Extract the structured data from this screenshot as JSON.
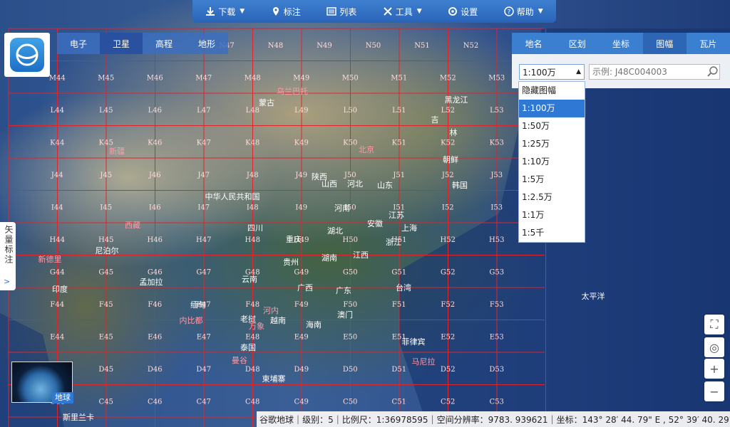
{
  "toolbar": {
    "items": [
      {
        "label": "下载",
        "icon": "download-icon",
        "has_caret": true
      },
      {
        "label": "标注",
        "icon": "location-pin-icon",
        "has_caret": false
      },
      {
        "label": "列表",
        "icon": "list-icon",
        "has_caret": false
      },
      {
        "label": "工具",
        "icon": "tools-icon",
        "has_caret": true
      },
      {
        "label": "设置",
        "icon": "gear-icon",
        "has_caret": false
      },
      {
        "label": "帮助",
        "icon": "help-icon",
        "has_caret": true
      }
    ]
  },
  "map_tabs": [
    "电子",
    "卫星",
    "高程",
    "地形"
  ],
  "map_tabs_active": "卫星",
  "panel": {
    "tabs": [
      "地名",
      "区划",
      "坐标",
      "图幅",
      "瓦片"
    ],
    "active_tab": "图幅",
    "scale_selected": "1:100万",
    "search_placeholder": "示例: J48C004003",
    "scale_options": [
      "隐藏图幅",
      "1:100万",
      "1:50万",
      "1:25万",
      "1:10万",
      "1:5万",
      "1:2.5万",
      "1:1万",
      "1:5千"
    ]
  },
  "vector_label_tab": "矢量标注",
  "minimap_label": "地球",
  "status": {
    "source": "谷歌地球",
    "level": "级别：5",
    "scale": "比例尺：1:36978595",
    "resolution": "空间分辨率：9783. 939621",
    "coords": "坐标：143° 28′ 44. 79\" E , 52° 39′ 40. 29\" N"
  },
  "grid": {
    "rows": [
      "M",
      "L",
      "K",
      "J",
      "I",
      "H",
      "G",
      "F",
      "E",
      "D",
      "C"
    ],
    "cols": [
      44,
      45,
      46,
      47,
      48,
      49,
      50,
      51,
      52,
      53
    ],
    "top_row_labels": [
      "N47",
      "N48",
      "N49",
      "N50",
      "N51",
      "N52"
    ]
  },
  "places": [
    {
      "name": "蒙古",
      "red": false
    },
    {
      "name": "中华人民共和国",
      "red": false
    },
    {
      "name": "黑龙江",
      "red": false
    },
    {
      "name": "吉",
      "red": false
    },
    {
      "name": "林",
      "red": false
    },
    {
      "name": "朝鲜",
      "red": false
    },
    {
      "name": "韩国",
      "red": false
    },
    {
      "name": "北京",
      "red": true
    },
    {
      "name": "新疆",
      "red": true
    },
    {
      "name": "西藏",
      "red": true
    },
    {
      "name": "四川",
      "red": false
    },
    {
      "name": "湖北",
      "red": false
    },
    {
      "name": "安徽",
      "red": false
    },
    {
      "name": "上海",
      "red": false
    },
    {
      "name": "浙江",
      "red": false
    },
    {
      "name": "湖南",
      "red": false
    },
    {
      "name": "江西",
      "red": false
    },
    {
      "name": "重庆",
      "red": false
    },
    {
      "name": "贵州",
      "red": false
    },
    {
      "name": "云南",
      "red": false
    },
    {
      "name": "广西",
      "red": false
    },
    {
      "name": "广东",
      "red": false
    },
    {
      "name": "台湾",
      "red": false
    },
    {
      "name": "海南",
      "red": false
    },
    {
      "name": "澳门",
      "red": false
    },
    {
      "name": "河南",
      "red": false
    },
    {
      "name": "陕西",
      "red": false
    },
    {
      "name": "山西",
      "red": false
    },
    {
      "name": "河北",
      "red": false
    },
    {
      "name": "山东",
      "red": false
    },
    {
      "name": "江苏",
      "red": false
    },
    {
      "name": "尼泊尔",
      "red": false
    },
    {
      "name": "印度",
      "red": false
    },
    {
      "name": "孟加拉",
      "red": false
    },
    {
      "name": "缅甸",
      "red": false
    },
    {
      "name": "老挝",
      "red": false
    },
    {
      "name": "越南",
      "red": false
    },
    {
      "name": "泰国",
      "red": false
    },
    {
      "name": "柬埔寨",
      "red": false
    },
    {
      "name": "菲律宾",
      "red": false
    },
    {
      "name": "太平洋",
      "red": false
    },
    {
      "name": "斯里兰卡",
      "red": false
    },
    {
      "name": "河内",
      "red": true
    },
    {
      "name": "万象",
      "red": true
    },
    {
      "name": "内比都",
      "red": true
    },
    {
      "name": "曼谷",
      "red": true
    },
    {
      "name": "新德里",
      "red": true
    },
    {
      "name": "马尼拉",
      "red": true
    },
    {
      "name": "乌兰巴托",
      "red": true
    }
  ]
}
